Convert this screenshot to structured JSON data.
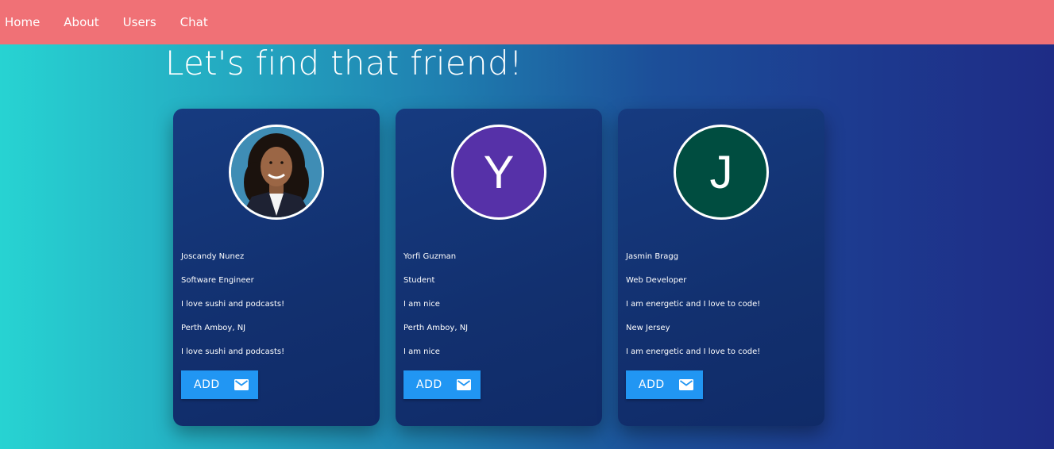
{
  "nav": {
    "items": [
      {
        "label": "Home"
      },
      {
        "label": "About"
      },
      {
        "label": "Users"
      },
      {
        "label": "Chat"
      }
    ]
  },
  "header": {
    "title": "Let's find that friend!"
  },
  "cards": [
    {
      "avatar": {
        "type": "photo",
        "letter": "",
        "color": "#3a86ad"
      },
      "name": "Joscandy Nunez",
      "occupation": "Software Engineer",
      "bio": "I love sushi and podcasts!",
      "location": "Perth Amboy, NJ",
      "bio_repeat": "I love sushi and podcasts!",
      "add_label": "ADD"
    },
    {
      "avatar": {
        "type": "letter",
        "letter": "Y",
        "color": "#5631a8"
      },
      "name": "Yorfi Guzman",
      "occupation": "Student",
      "bio": "I am nice",
      "location": "Perth Amboy, NJ",
      "bio_repeat": "I am nice",
      "add_label": "ADD"
    },
    {
      "avatar": {
        "type": "letter",
        "letter": "J",
        "color": "#004d40"
      },
      "name": "Jasmin Bragg",
      "occupation": "Web Developer",
      "bio": "I am energetic and I love to code!",
      "location": "New Jersey",
      "bio_repeat": "I am energetic and I love to code!",
      "add_label": "ADD"
    }
  ],
  "colors": {
    "navbar": "#f07176",
    "button": "#2196f3",
    "card": "#12306f"
  }
}
